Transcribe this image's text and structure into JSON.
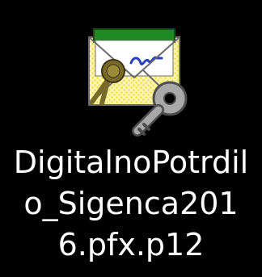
{
  "desktop_icon": {
    "icon": "certificate-key-icon",
    "label_lines": [
      "DigitalnoPotrdil",
      "o_Sigenca201",
      "6.pfx.p12"
    ]
  },
  "colors": {
    "background": "#000000",
    "label_text": "#ffffff",
    "envelope_yellow": "#fff6a8",
    "envelope_dots": "#e8d34a",
    "certificate_green": "#1f8a24",
    "certificate_paper": "#ffffff",
    "seal_ribbon": "#7a6a2a",
    "signature_blue": "#2a3fbf",
    "key_gray": "#a9a9a9"
  }
}
